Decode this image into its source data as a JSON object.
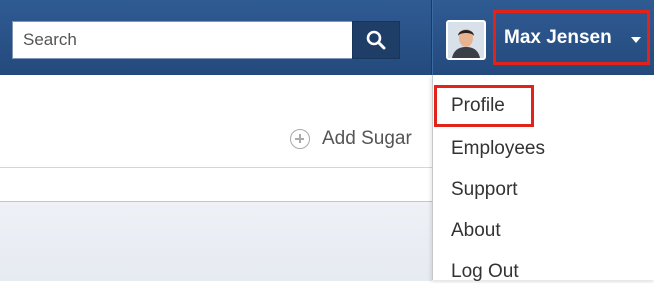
{
  "search": {
    "placeholder": "Search"
  },
  "user": {
    "name": "Max Jensen"
  },
  "actions": {
    "add_label": "Add Sugar"
  },
  "dropdown": {
    "items": [
      {
        "label": "Profile"
      },
      {
        "label": "Employees"
      },
      {
        "label": "Support"
      },
      {
        "label": "About"
      },
      {
        "label": "Log Out"
      }
    ]
  },
  "colors": {
    "header": "#2a5288",
    "highlight": "#e2231a"
  },
  "icons": [
    "search-icon",
    "avatar",
    "caret-down-icon",
    "add-icon"
  ]
}
